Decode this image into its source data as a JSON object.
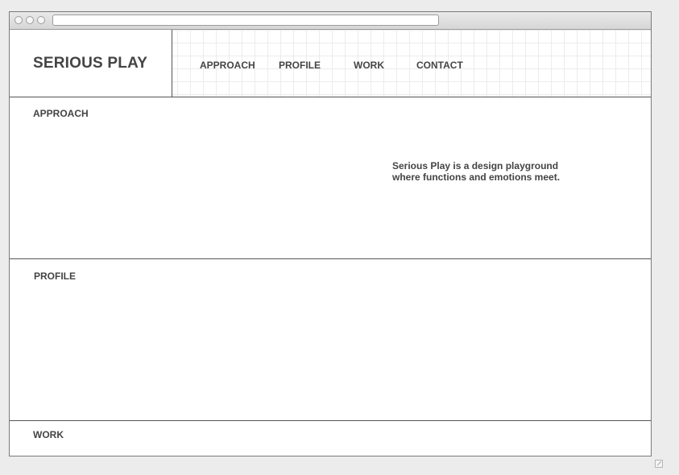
{
  "site": {
    "logo": "SERIOUS PLAY"
  },
  "nav": {
    "items": [
      {
        "label": "APPROACH"
      },
      {
        "label": "PROFILE"
      },
      {
        "label": "WORK"
      },
      {
        "label": "CONTACT"
      }
    ]
  },
  "sections": {
    "approach": {
      "title": "APPROACH",
      "tagline_line1": "Serious Play is a design playground",
      "tagline_line2": "where functions and emotions meet."
    },
    "profile": {
      "title": "PROFILE"
    },
    "work": {
      "title": "WORK"
    }
  },
  "colors": {
    "background": "#ececec",
    "text": "#444444",
    "border": "#555555",
    "grid": "#ececec"
  },
  "icons": {
    "window_controls": [
      "close-icon",
      "minimize-icon",
      "zoom-icon"
    ],
    "resize": "resize-grip-icon"
  }
}
